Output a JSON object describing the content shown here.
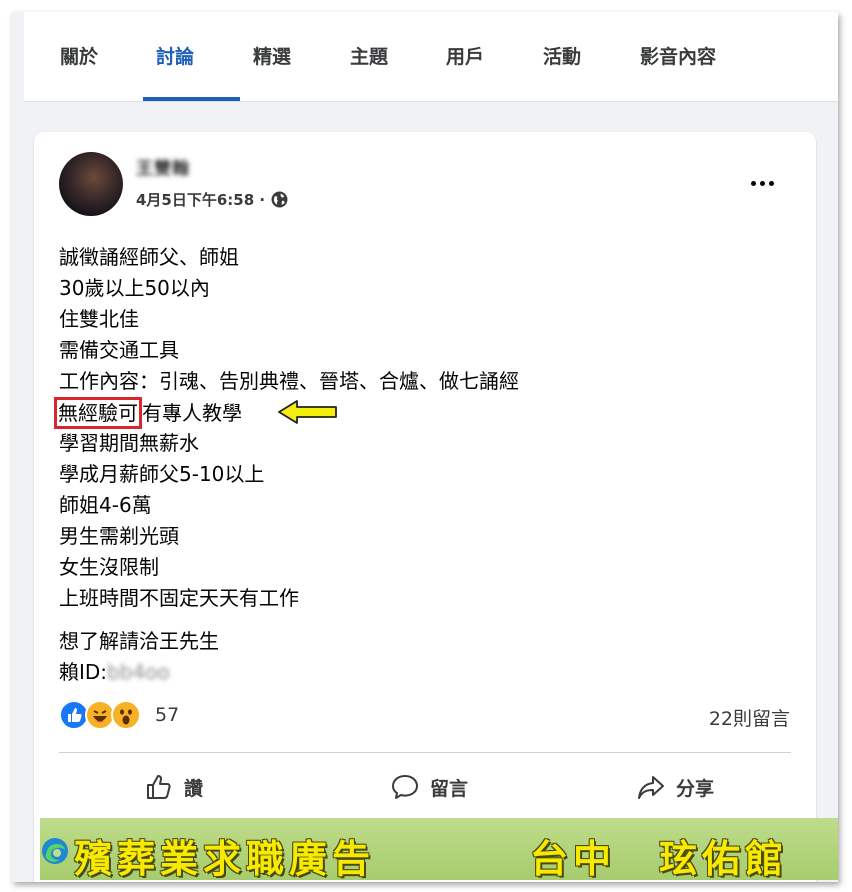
{
  "tabs": [
    "關於",
    "討論",
    "精選",
    "主題",
    "用戶",
    "活動",
    "影音內容"
  ],
  "post": {
    "author": "王雙翰",
    "timestamp": "4月5日下午6:58 ·",
    "lines": [
      "誠徵誦經師父、師姐",
      "30歲以上50以內",
      "住雙北佳",
      "需備交通工具",
      "工作內容：引魂、告別典禮、晉塔、合爐、做七誦經",
      "有專人教學",
      "學習期間無薪水",
      "學成月薪師父5-10以上",
      "師姐4-6萬",
      "男生需剃光頭",
      "女生沒限制",
      "上班時間不固定天天有工作",
      "想了解請洽王先生",
      "賴ID:",
      "bb4oo"
    ],
    "highlight": "無經驗可",
    "reaction_count": "57",
    "comment_count": "22則留言"
  },
  "actions": {
    "like": "讚",
    "comment": "留言",
    "share": "分享"
  },
  "banner": {
    "left": "殯葬業求職廣告",
    "right": "台中　玹佑館"
  },
  "colors": {
    "accent": "#1f5fb8",
    "highlight_box": "#d9262c",
    "arrow": "#f3ee0c",
    "banner_bg": "#bedc8a",
    "banner_text": "#f7ea00"
  },
  "icons": [
    "globe-icon",
    "more-icon",
    "arrow-icon",
    "like-reaction-icon",
    "haha-reaction-icon",
    "wow-reaction-icon",
    "thumbs-up-icon",
    "comment-icon",
    "share-icon",
    "edge-icon"
  ]
}
